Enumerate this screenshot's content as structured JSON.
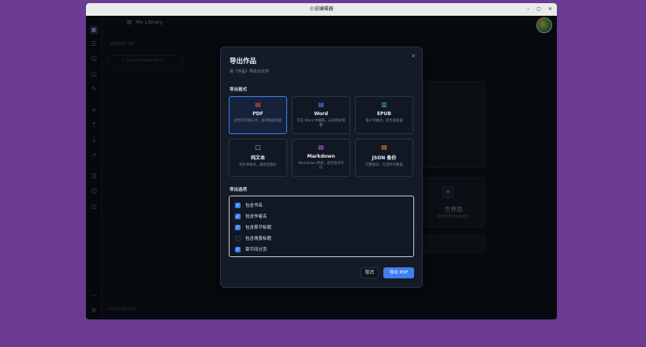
{
  "window": {
    "title": "小说编辑器",
    "minimize": "–",
    "maximize": "▢",
    "close": "✕"
  },
  "library": {
    "title": "My Library",
    "books_label": "BOOKS (0)",
    "create_label": "+  Create New Book",
    "archive_label": "Library Archive",
    "archive_more": "···"
  },
  "background": {
    "worldview_title": "世界观",
    "worldview_desc": "构建完整的故事世界"
  },
  "modal": {
    "title": "导出作品",
    "subtitle": "将《作品》导出为文件",
    "close": "×",
    "format_section": "导出格式",
    "formats": [
      {
        "name": "PDF",
        "desc": "适合打印和分享，保持精美排版",
        "icon": "pdf-file-icon",
        "color": "#e0533c",
        "selected": true
      },
      {
        "name": "Word",
        "desc": "可在 Word 中编辑，支持格式调整",
        "icon": "word-file-icon",
        "color": "#4a8cf0",
        "selected": false
      },
      {
        "name": "EPUB",
        "desc": "电子书格式，适合阅读器",
        "icon": "book-open-icon",
        "color": "#3fbf7f",
        "selected": false
      },
      {
        "name": "纯文本",
        "desc": "纯文本格式，兼容性最好",
        "icon": "text-file-icon",
        "color": "#b9c0cc",
        "selected": false
      },
      {
        "name": "Markdown",
        "desc": "Markdown 格式，适合技术写作",
        "icon": "markdown-file-icon",
        "color": "#b55ee0",
        "selected": false
      },
      {
        "name": "JSON 备份",
        "desc": "完整备份，包含所有数据",
        "icon": "json-file-icon",
        "color": "#e5823a",
        "selected": false
      }
    ],
    "options_section": "导出选项",
    "options": [
      {
        "label": "包含书名",
        "checked": true
      },
      {
        "label": "包含作者名",
        "checked": true
      },
      {
        "label": "包含章节标题",
        "checked": true
      },
      {
        "label": "包含场景标题",
        "checked": false
      },
      {
        "label": "章节间分页",
        "checked": true
      }
    ],
    "cancel_label": "取消",
    "export_label": "导出 PDF"
  }
}
